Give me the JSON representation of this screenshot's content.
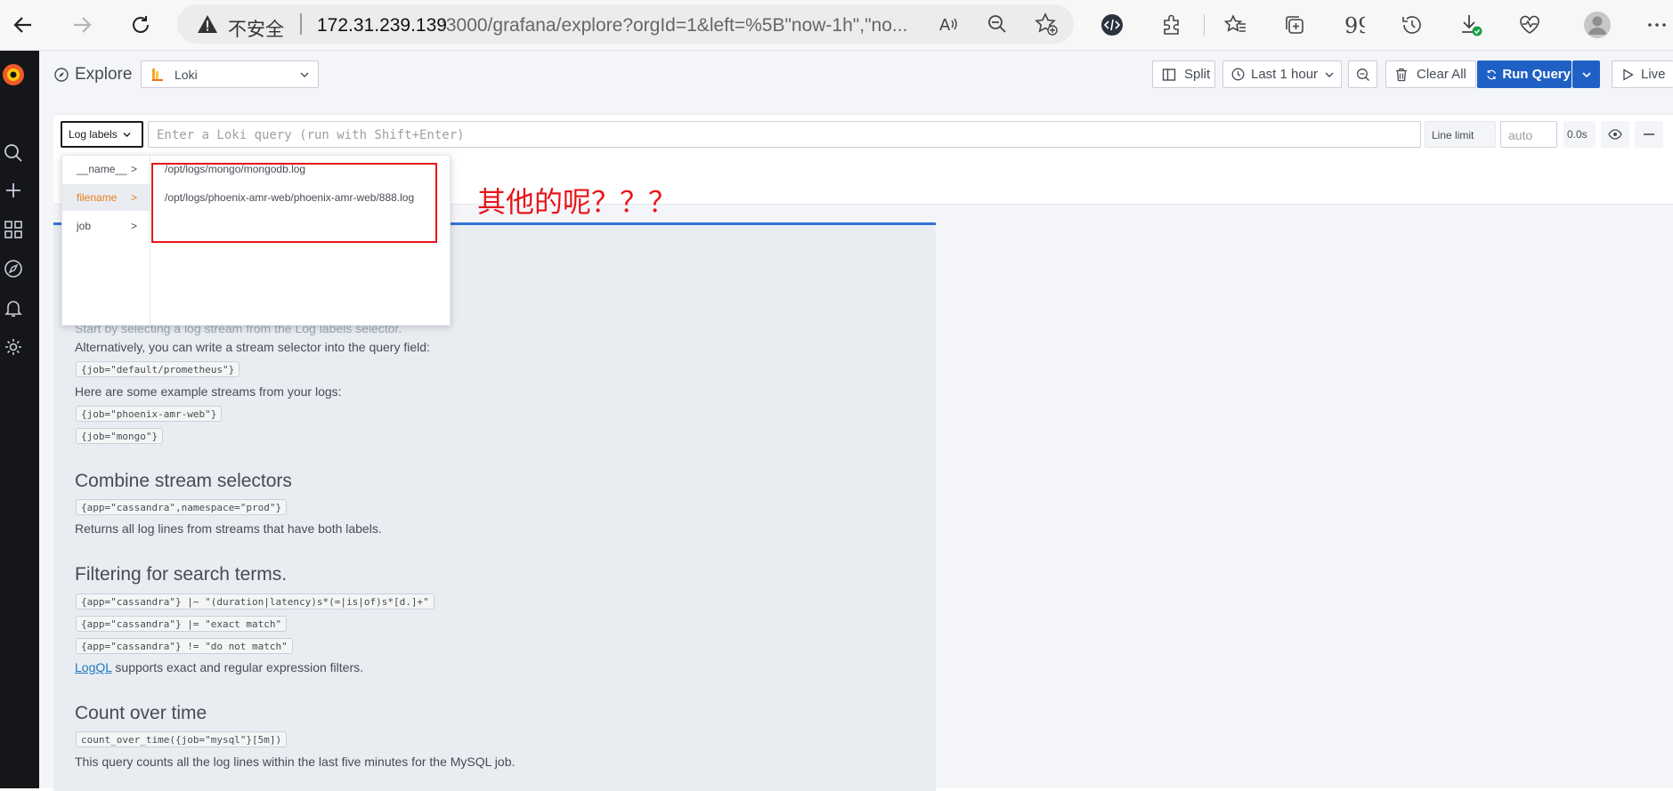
{
  "browser": {
    "security_label": "不安全",
    "url_host": "172.31.239.139",
    "url_rest": ":3000/grafana/explore?orgId=1&left=%5B\"now-1h\",\"no..."
  },
  "explore": {
    "title": "Explore",
    "datasource": "Loki",
    "split_label": "Split",
    "time_range": "Last 1 hour",
    "clear_all_label": "Clear All",
    "run_query_label": "Run Query",
    "live_label": "Live"
  },
  "query": {
    "log_labels_button": "Log labels",
    "placeholder": "Enter a Loki query (run with Shift+Enter)",
    "line_limit_label": "Line limit",
    "line_limit_placeholder": "auto",
    "time_taken": "0.0s"
  },
  "label_browser": {
    "labels": [
      {
        "name": "__name__",
        "arrow": ">"
      },
      {
        "name": "filename",
        "arrow": ">"
      },
      {
        "name": "job",
        "arrow": ">"
      }
    ],
    "values": [
      "/opt/logs/mongo/mongodb.log",
      "/opt/logs/phoenix-amr-web/phoenix-amr-web/888.log"
    ]
  },
  "annotation": {
    "text": "其他的呢？？？"
  },
  "cheat_sheet": {
    "intro_line1": "Start by selecting a log stream from the Log labels selector.",
    "intro_line2": "Alternatively, you can write a stream selector into the query field:",
    "example1": "{job=\"default/prometheus\"}",
    "intro_line3": "Here are some example streams from your logs:",
    "example2": "{job=\"phoenix-amr-web\"}",
    "example3": "{job=\"mongo\"}",
    "combine_title": "Combine stream selectors",
    "combine_code": "{app=\"cassandra\",namespace=\"prod\"}",
    "combine_desc": "Returns all log lines from streams that have both labels.",
    "filter_title": "Filtering for search terms.",
    "filter_code1": "{app=\"cassandra\"} |~ \"(duration|latency)s*(=|is|of)s*[d.]+\"",
    "filter_code2": "{app=\"cassandra\"} |= \"exact match\"",
    "filter_code3": "{app=\"cassandra\"} != \"do not match\"",
    "filter_link": "LogQL",
    "filter_desc": " supports exact and regular expression filters.",
    "count_title": "Count over time",
    "count_code": "count_over_time({job=\"mysql\"}[5m])",
    "count_desc": "This query counts all the log lines within the last five minutes for the MySQL job."
  },
  "colors": {
    "accent_blue": "#1f60c4",
    "active_label_orange": "#eb7b18",
    "annotation_red": "#e8161b",
    "sidemenu_bg": "#141619"
  }
}
